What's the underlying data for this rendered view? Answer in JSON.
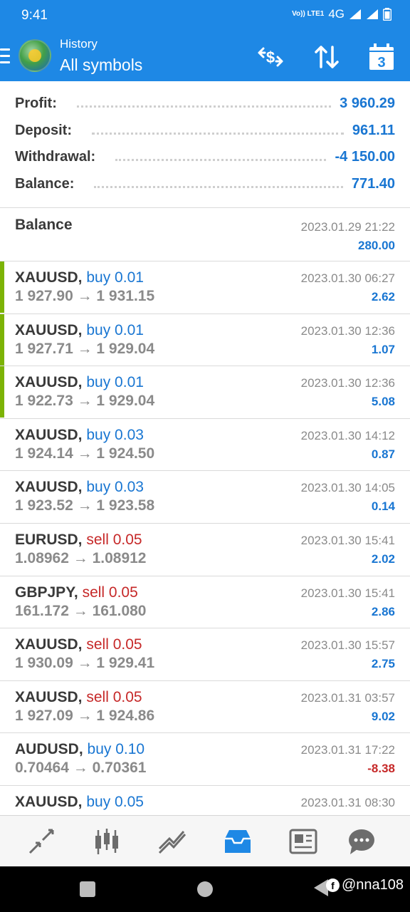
{
  "status_bar": {
    "time": "9:41",
    "network": "4G",
    "volte": "Vo)) LTE1"
  },
  "app_bar": {
    "subtitle": "History",
    "title": "All symbols"
  },
  "summary": [
    {
      "label": "Profit:",
      "value": "3 960.29"
    },
    {
      "label": "Deposit:",
      "value": "961.11"
    },
    {
      "label": "Withdrawal:",
      "value": "-4 150.00"
    },
    {
      "label": "Balance:",
      "value": "771.40"
    }
  ],
  "balance_entry": {
    "label": "Balance",
    "time": "2023.01.29 21:22",
    "amount": "280.00"
  },
  "deals": [
    {
      "symbol": "XAUUSD,",
      "direction": "buy 0.01",
      "prices": "1 927.90 → 1 931.15",
      "time": "2023.01.30 06:27",
      "profit": "2.62"
    },
    {
      "symbol": "XAUUSD,",
      "direction": "buy 0.01",
      "prices": "1 927.71 → 1 929.04",
      "time": "2023.01.30 12:36",
      "profit": "1.07"
    },
    {
      "symbol": "XAUUSD,",
      "direction": "buy 0.01",
      "prices": "1 922.73 → 1 929.04",
      "time": "2023.01.30 12:36",
      "profit": "5.08"
    },
    {
      "symbol": "XAUUSD,",
      "direction": "buy 0.03",
      "prices": "1 924.14 → 1 924.50",
      "time": "2023.01.30 14:12",
      "profit": "0.87"
    },
    {
      "symbol": "XAUUSD,",
      "direction": "buy 0.03",
      "prices": "1 923.52 → 1 923.58",
      "time": "2023.01.30 14:05",
      "profit": "0.14"
    },
    {
      "symbol": "EURUSD,",
      "direction": "sell 0.05",
      "prices": "1.08962 → 1.08912",
      "time": "2023.01.30 15:41",
      "profit": "2.02"
    },
    {
      "symbol": "GBPJPY,",
      "direction": "sell 0.05",
      "prices": "161.172 → 161.080",
      "time": "2023.01.30 15:41",
      "profit": "2.86"
    },
    {
      "symbol": "XAUUSD,",
      "direction": "sell 0.05",
      "prices": "1 930.09 → 1 929.41",
      "time": "2023.01.30 15:57",
      "profit": "2.75"
    },
    {
      "symbol": "XAUUSD,",
      "direction": "sell 0.05",
      "prices": "1 927.09 → 1 924.86",
      "time": "2023.01.31 03:57",
      "profit": "9.02"
    },
    {
      "symbol": "AUDUSD,",
      "direction": "buy 0.10",
      "prices": "0.70464 → 0.70361",
      "time": "2023.01.31 17:22",
      "profit": "-8.38"
    },
    {
      "symbol": "XAUUSD,",
      "direction": "buy 0.05",
      "prices": "",
      "time": "2023.01.31 08:30",
      "profit": ""
    }
  ],
  "colors": {
    "brand": "#1e88e5",
    "buy": "#1976d2",
    "sell": "#c62828",
    "accent": "#7cb305"
  },
  "icons": [
    "menu-icon",
    "deposit-exchange-icon",
    "sort-icon",
    "calendar-icon",
    "trade-icon",
    "quotes-icon",
    "chart-icon",
    "history-icon",
    "news-icon",
    "chat-icon"
  ],
  "calendar_day": "3",
  "watermark": {
    "handle": "@nna108"
  }
}
